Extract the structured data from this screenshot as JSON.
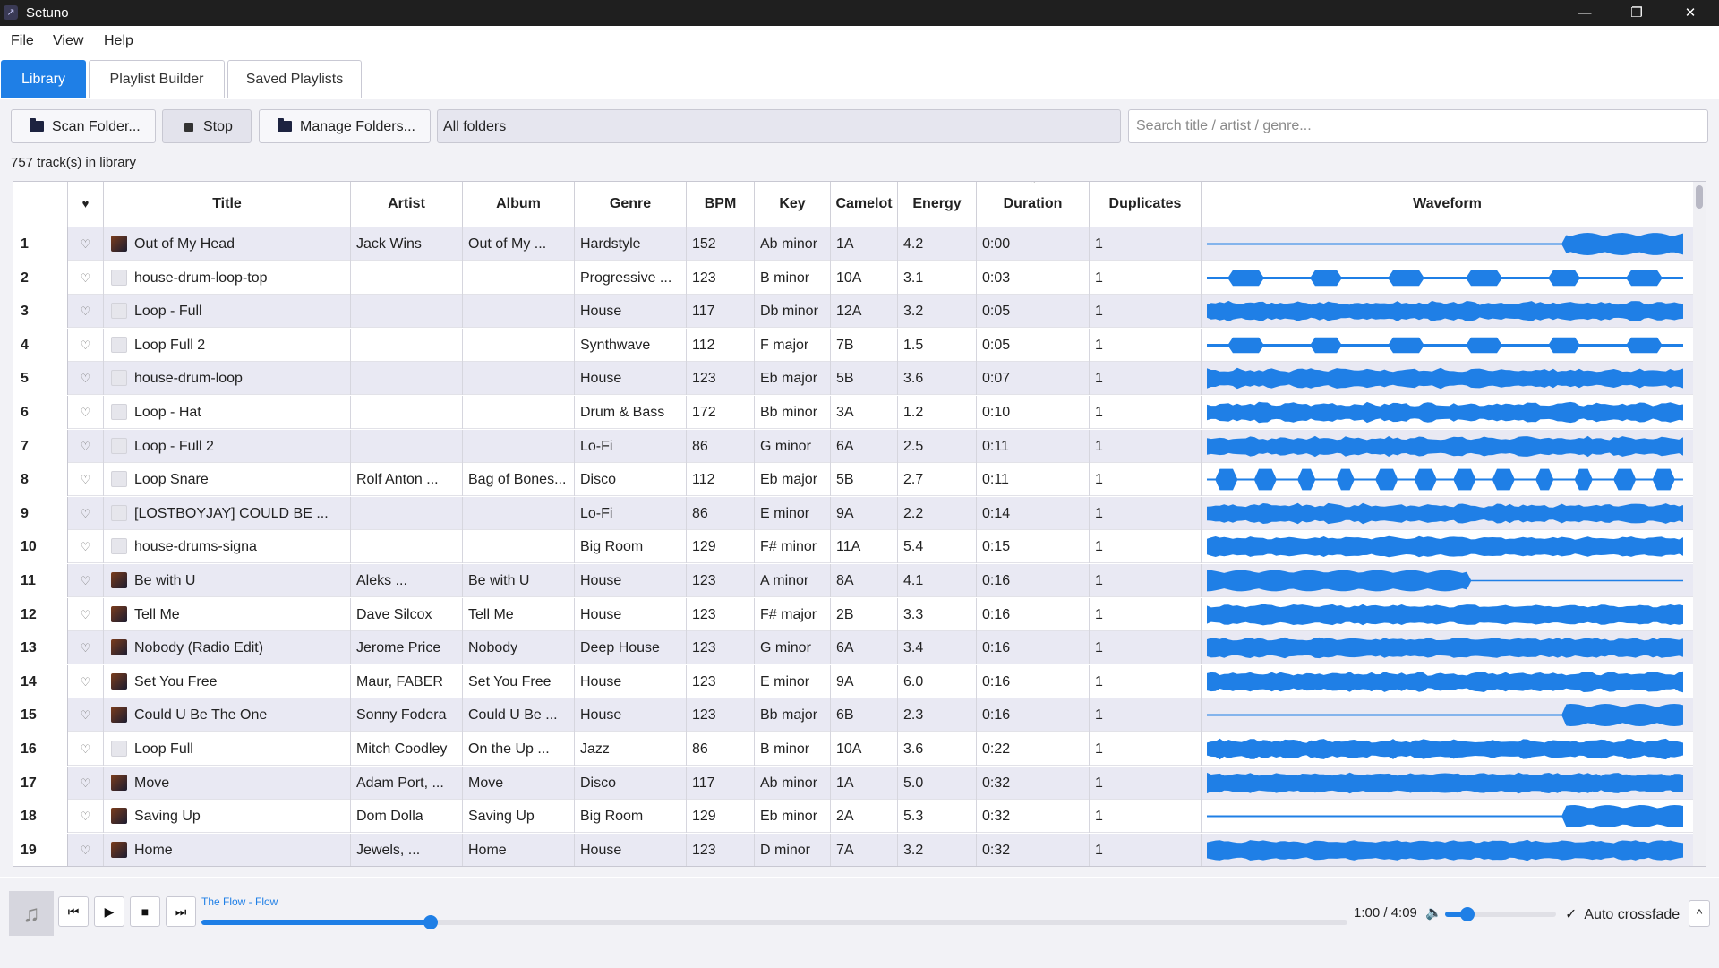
{
  "window": {
    "title": "Setuno",
    "minimize": "—",
    "restore": "❐",
    "close": "✕",
    "app_icon": "↗"
  },
  "menu": [
    "File",
    "View",
    "Help"
  ],
  "tabs": [
    {
      "label": "Library",
      "active": true
    },
    {
      "label": "Playlist Builder",
      "active": false
    },
    {
      "label": "Saved Playlists",
      "active": false
    }
  ],
  "toolbar": {
    "scan_label": "Scan Folder...",
    "stop_label": "Stop",
    "manage_label": "Manage Folders...",
    "folder_filter": "All folders",
    "search_placeholder": "Search title / artist / genre..."
  },
  "library_count": "757 track(s) in library",
  "columns": {
    "fav": "♥",
    "title": "Title",
    "artist": "Artist",
    "album": "Album",
    "genre": "Genre",
    "bpm": "BPM",
    "key": "Key",
    "camelot": "Camelot",
    "energy": "Energy",
    "duration": "Duration",
    "duplicates": "Duplicates",
    "waveform": "Waveform",
    "sort_indicator": "^"
  },
  "fav_glyph": "♡",
  "tracks": [
    {
      "n": "1",
      "title": "Out of My Head",
      "artist": "Jack Wins",
      "album": "Out of My ...",
      "genre": "Hardstyle",
      "bpm": "152",
      "key": "Ab minor",
      "camelot": "1A",
      "energy": "4.2",
      "duration": "0:00",
      "dup": "1",
      "art": true,
      "wave": "late"
    },
    {
      "n": "2",
      "title": "house-drum-loop-top",
      "artist": "",
      "album": "",
      "genre": "Progressive ...",
      "bpm": "123",
      "key": "B minor",
      "camelot": "10A",
      "energy": "3.1",
      "duration": "0:03",
      "dup": "1",
      "art": false,
      "wave": "pulse"
    },
    {
      "n": "3",
      "title": "Loop - Full",
      "artist": "",
      "album": "",
      "genre": "House",
      "bpm": "117",
      "key": "Db minor",
      "camelot": "12A",
      "energy": "3.2",
      "duration": "0:05",
      "dup": "1",
      "art": false,
      "wave": "dense"
    },
    {
      "n": "4",
      "title": "Loop Full 2",
      "artist": "",
      "album": "",
      "genre": "Synthwave",
      "bpm": "112",
      "key": "F major",
      "camelot": "7B",
      "energy": "1.5",
      "duration": "0:05",
      "dup": "1",
      "art": false,
      "wave": "pulse"
    },
    {
      "n": "5",
      "title": "house-drum-loop",
      "artist": "",
      "album": "",
      "genre": "House",
      "bpm": "123",
      "key": "Eb major",
      "camelot": "5B",
      "energy": "3.6",
      "duration": "0:07",
      "dup": "1",
      "art": false,
      "wave": "dense"
    },
    {
      "n": "6",
      "title": "Loop - Hat",
      "artist": "",
      "album": "",
      "genre": "Drum & Bass",
      "bpm": "172",
      "key": "Bb minor",
      "camelot": "3A",
      "energy": "1.2",
      "duration": "0:10",
      "dup": "1",
      "art": false,
      "wave": "dense"
    },
    {
      "n": "7",
      "title": "Loop - Full 2",
      "artist": "",
      "album": "",
      "genre": "Lo-Fi",
      "bpm": "86",
      "key": "G minor",
      "camelot": "6A",
      "energy": "2.5",
      "duration": "0:11",
      "dup": "1",
      "art": false,
      "wave": "dense"
    },
    {
      "n": "8",
      "title": "Loop Snare",
      "artist": "Rolf Anton ...",
      "album": "Bag of Bones...",
      "genre": "Disco",
      "bpm": "112",
      "key": "Eb major",
      "camelot": "5B",
      "energy": "2.7",
      "duration": "0:11",
      "dup": "1",
      "art": false,
      "wave": "beats"
    },
    {
      "n": "9",
      "title": "[LOSTBOYJAY] COULD BE ...",
      "artist": "",
      "album": "",
      "genre": "Lo-Fi",
      "bpm": "86",
      "key": "E minor",
      "camelot": "9A",
      "energy": "2.2",
      "duration": "0:14",
      "dup": "1",
      "art": false,
      "wave": "dense"
    },
    {
      "n": "10",
      "title": "house-drums-signa",
      "artist": "",
      "album": "",
      "genre": "Big Room",
      "bpm": "129",
      "key": "F# minor",
      "camelot": "11A",
      "energy": "5.4",
      "duration": "0:15",
      "dup": "1",
      "art": false,
      "wave": "full"
    },
    {
      "n": "11",
      "title": "Be with U",
      "artist": "Aleks ...",
      "album": "Be with U",
      "genre": "House",
      "bpm": "123",
      "key": "A minor",
      "camelot": "8A",
      "energy": "4.1",
      "duration": "0:16",
      "dup": "1",
      "art": true,
      "wave": "early"
    },
    {
      "n": "12",
      "title": "Tell Me",
      "artist": "Dave Silcox",
      "album": "Tell Me",
      "genre": "House",
      "bpm": "123",
      "key": "F# major",
      "camelot": "2B",
      "energy": "3.3",
      "duration": "0:16",
      "dup": "1",
      "art": true,
      "wave": "full"
    },
    {
      "n": "13",
      "title": "Nobody (Radio Edit)",
      "artist": "Jerome Price",
      "album": "Nobody",
      "genre": "Deep House",
      "bpm": "123",
      "key": "G minor",
      "camelot": "6A",
      "energy": "3.4",
      "duration": "0:16",
      "dup": "1",
      "art": true,
      "wave": "full"
    },
    {
      "n": "14",
      "title": "Set You Free",
      "artist": "Maur, FABER",
      "album": "Set You Free",
      "genre": "House",
      "bpm": "123",
      "key": "E minor",
      "camelot": "9A",
      "energy": "6.0",
      "duration": "0:16",
      "dup": "1",
      "art": true,
      "wave": "dense"
    },
    {
      "n": "15",
      "title": "Could U Be The One",
      "artist": "Sonny Fodera",
      "album": "Could U Be ...",
      "genre": "House",
      "bpm": "123",
      "key": "Bb major",
      "camelot": "6B",
      "energy": "2.3",
      "duration": "0:16",
      "dup": "1",
      "art": true,
      "wave": "late"
    },
    {
      "n": "16",
      "title": "Loop Full",
      "artist": "Mitch Coodley",
      "album": "On the Up ...",
      "genre": "Jazz",
      "bpm": "86",
      "key": "B minor",
      "camelot": "10A",
      "energy": "3.6",
      "duration": "0:22",
      "dup": "1",
      "art": false,
      "wave": "dense"
    },
    {
      "n": "17",
      "title": "Move",
      "artist": "Adam Port, ...",
      "album": "Move",
      "genre": "Disco",
      "bpm": "117",
      "key": "Ab minor",
      "camelot": "1A",
      "energy": "5.0",
      "duration": "0:32",
      "dup": "1",
      "art": true,
      "wave": "full"
    },
    {
      "n": "18",
      "title": "Saving Up",
      "artist": "Dom Dolla",
      "album": "Saving Up",
      "genre": "Big Room",
      "bpm": "129",
      "key": "Eb minor",
      "camelot": "2A",
      "energy": "5.3",
      "duration": "0:32",
      "dup": "1",
      "art": true,
      "wave": "late"
    },
    {
      "n": "19",
      "title": "Home",
      "artist": "Jewels, ...",
      "album": "Home",
      "genre": "House",
      "bpm": "123",
      "key": "D minor",
      "camelot": "7A",
      "energy": "3.2",
      "duration": "0:32",
      "dup": "1",
      "art": true,
      "wave": "full"
    }
  ],
  "player": {
    "now_playing": "The Flow - Flow",
    "time": "1:00 / 4:09",
    "progress": 0.2,
    "volume": 0.2,
    "crossfade_label": "Auto crossfade",
    "crossfade_checked": true,
    "album_icon": "♫",
    "prev": "⏮",
    "play": "▶",
    "stop": "■",
    "next": "⏭",
    "volume_icon": "🔈",
    "check": "✓",
    "expand": "^"
  },
  "colors": {
    "accent": "#1f7fe6",
    "row_alt": "#e9e9f3",
    "wave": "#1f7fe6"
  }
}
